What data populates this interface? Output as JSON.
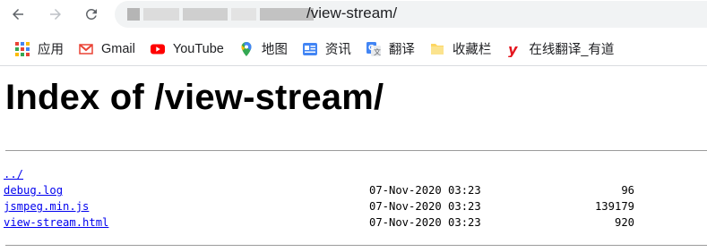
{
  "browser": {
    "back_icon": "arrow-left-icon",
    "forward_icon": "arrow-right-icon",
    "reload_icon": "reload-icon",
    "url_visible": "/view-stream/"
  },
  "bookmarks": [
    {
      "label": "应用",
      "icon": "apps-grid-icon"
    },
    {
      "label": "Gmail",
      "icon": "gmail-icon"
    },
    {
      "label": "YouTube",
      "icon": "youtube-icon"
    },
    {
      "label": "地图",
      "icon": "maps-pin-icon"
    },
    {
      "label": "资讯",
      "icon": "news-icon"
    },
    {
      "label": "翻译",
      "icon": "translate-icon"
    },
    {
      "label": "收藏栏",
      "icon": "folder-icon"
    },
    {
      "label": "在线翻译_有道",
      "icon": "youdao-icon"
    }
  ],
  "page": {
    "title": "Index of /view-stream/",
    "entries": [
      {
        "name": "../",
        "date": "",
        "size": ""
      },
      {
        "name": "debug.log",
        "date": "07-Nov-2020 03:23",
        "size": "96"
      },
      {
        "name": "jsmpeg.min.js",
        "date": "07-Nov-2020 03:23",
        "size": "139179"
      },
      {
        "name": "view-stream.html",
        "date": "07-Nov-2020 03:23",
        "size": "920"
      }
    ]
  },
  "colors": {
    "link": "#0000ee",
    "omnibox_bg": "#f1f3f4",
    "youtube_red": "#ff0000",
    "gmail_red": "#ea4335",
    "folder_yellow": "#fdd663"
  }
}
